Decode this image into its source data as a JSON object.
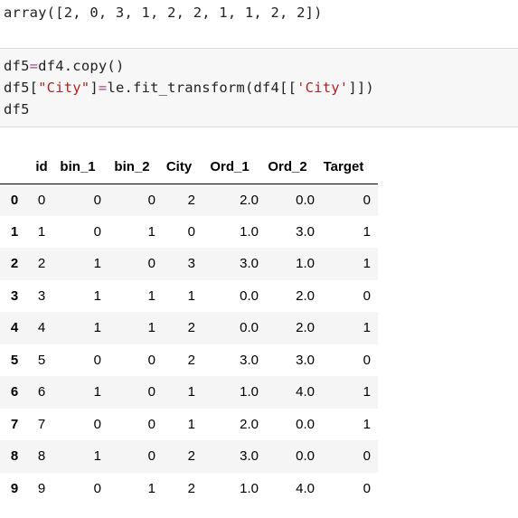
{
  "output": {
    "array_text": "array([2, 0, 3, 1, 2, 2, 1, 1, 2, 2])"
  },
  "code_cell": {
    "line1": {
      "a": "df5",
      "op": "=",
      "b": "df4.copy()"
    },
    "line2": {
      "a": "df5[",
      "s1": "\"City\"",
      "b": "]",
      "op": "=",
      "c": "le.fit_transform(df4[[",
      "s2": "'City'",
      "d": "]])"
    },
    "line3": "df5"
  },
  "dataframe": {
    "columns": [
      "id",
      "bin_1",
      "bin_2",
      "City",
      "Ord_1",
      "Ord_2",
      "Target"
    ],
    "rows": [
      {
        "index": "0",
        "cells": [
          "0",
          "0",
          "0",
          "2",
          "2.0",
          "0.0",
          "0"
        ]
      },
      {
        "index": "1",
        "cells": [
          "1",
          "0",
          "1",
          "0",
          "1.0",
          "3.0",
          "1"
        ]
      },
      {
        "index": "2",
        "cells": [
          "2",
          "1",
          "0",
          "3",
          "3.0",
          "1.0",
          "1"
        ]
      },
      {
        "index": "3",
        "cells": [
          "3",
          "1",
          "1",
          "1",
          "0.0",
          "2.0",
          "0"
        ]
      },
      {
        "index": "4",
        "cells": [
          "4",
          "1",
          "1",
          "2",
          "0.0",
          "2.0",
          "1"
        ]
      },
      {
        "index": "5",
        "cells": [
          "5",
          "0",
          "0",
          "2",
          "3.0",
          "3.0",
          "0"
        ]
      },
      {
        "index": "6",
        "cells": [
          "6",
          "1",
          "0",
          "1",
          "1.0",
          "4.0",
          "1"
        ]
      },
      {
        "index": "7",
        "cells": [
          "7",
          "0",
          "0",
          "1",
          "2.0",
          "0.0",
          "1"
        ]
      },
      {
        "index": "8",
        "cells": [
          "8",
          "1",
          "0",
          "2",
          "3.0",
          "0.0",
          "0"
        ]
      },
      {
        "index": "9",
        "cells": [
          "9",
          "0",
          "1",
          "2",
          "1.0",
          "4.0",
          "0"
        ]
      }
    ]
  }
}
